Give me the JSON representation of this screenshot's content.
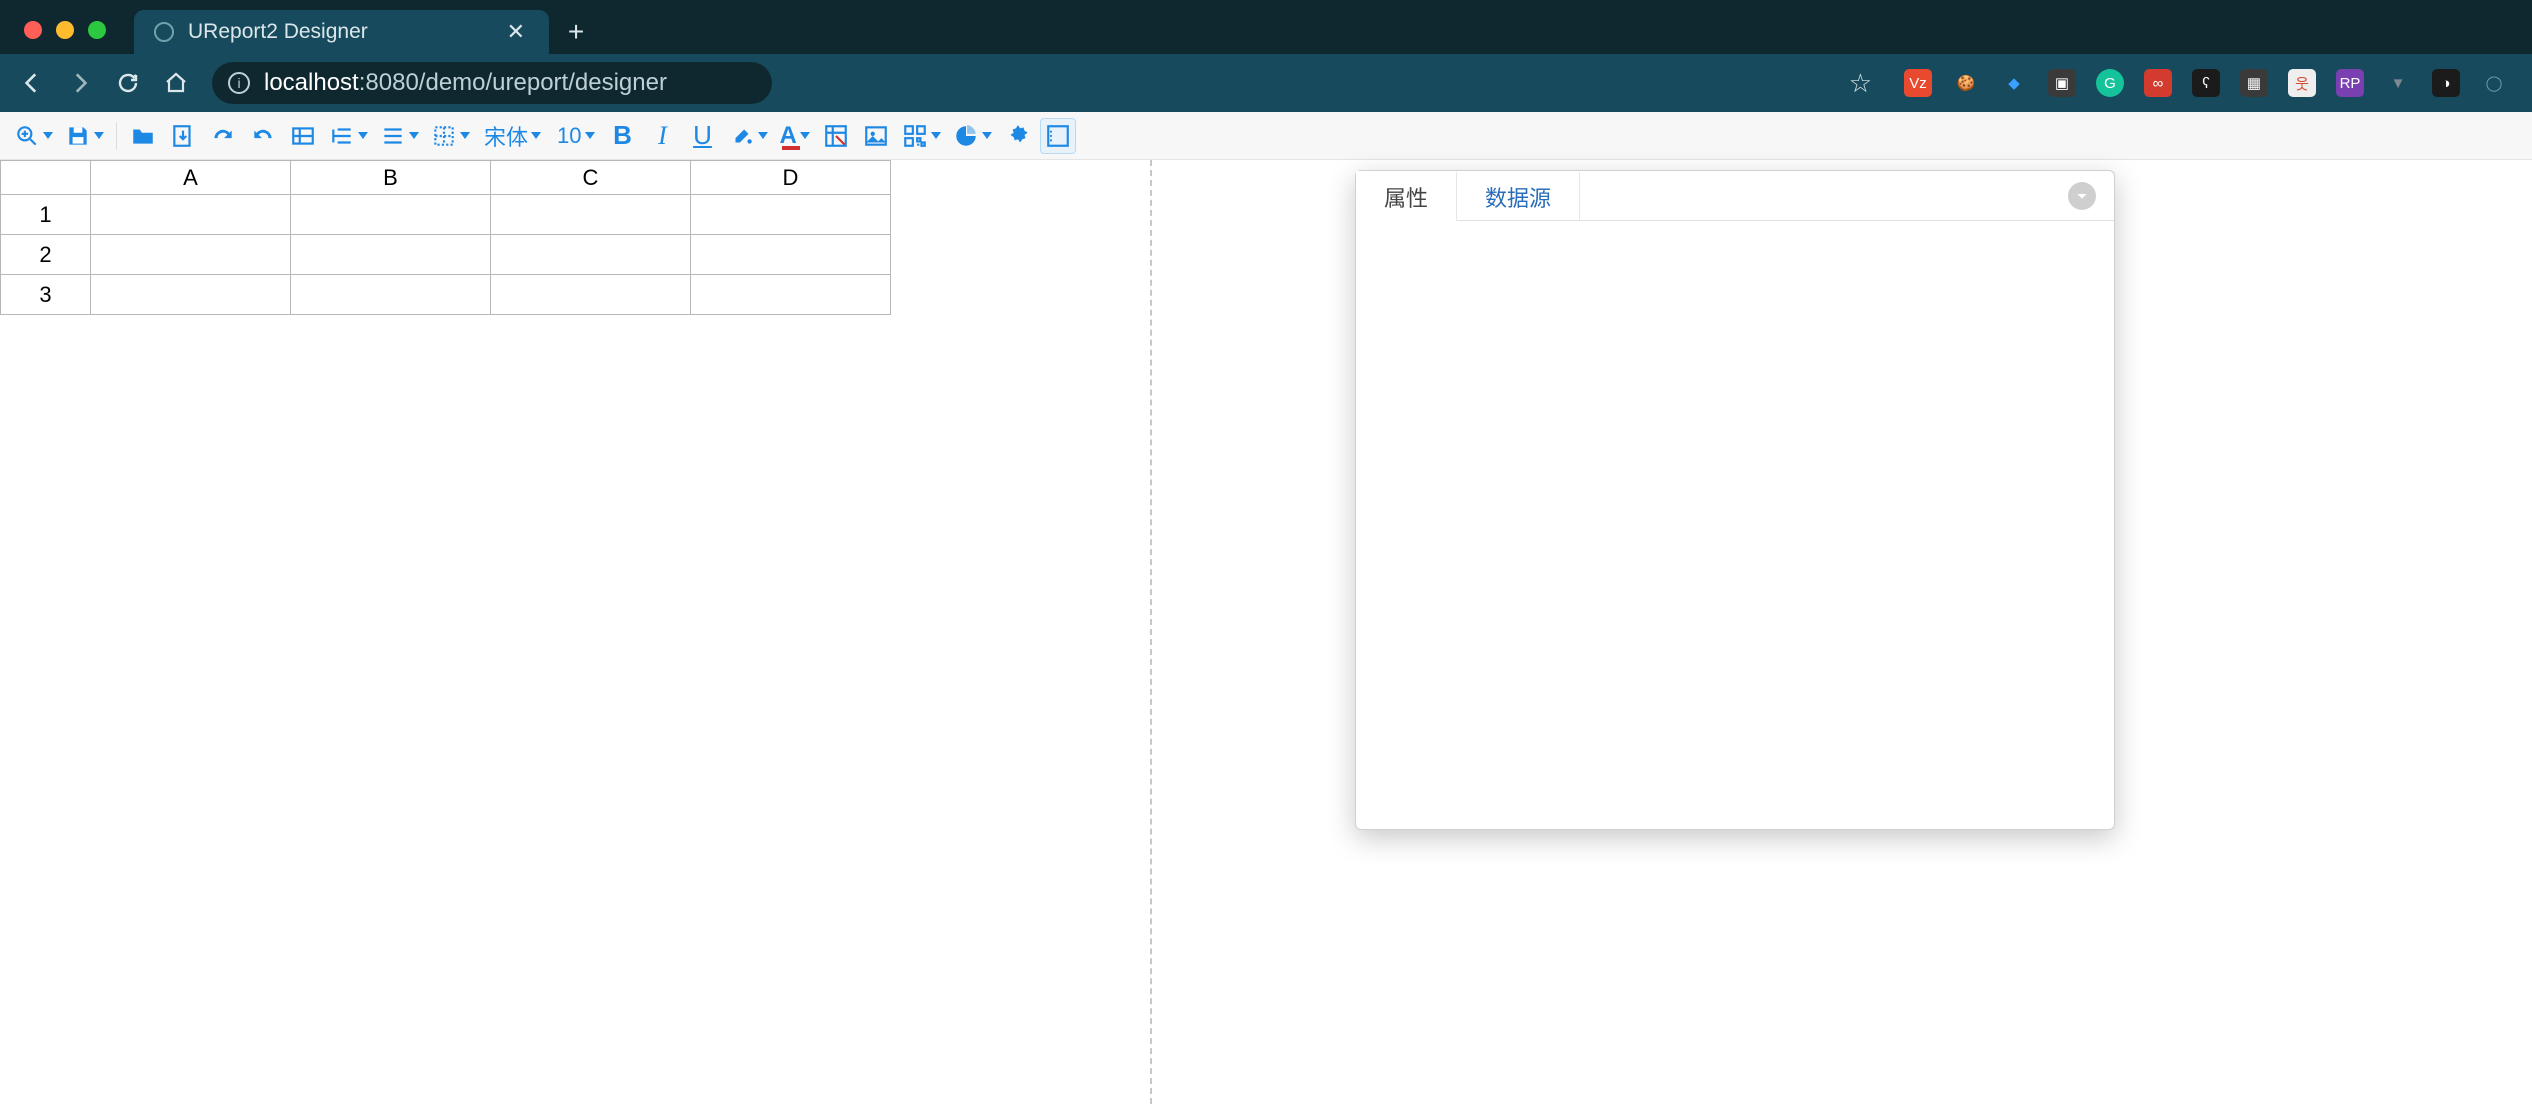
{
  "browser": {
    "tab_title": "UReport2 Designer",
    "url_host": "localhost",
    "url_port": ":8080",
    "url_path": "/demo/ureport/designer",
    "extensions": [
      {
        "name": "ext-1",
        "bg": "#e94a2f",
        "label": "Vz"
      },
      {
        "name": "ext-cookie",
        "bg": "transparent",
        "label": "🍪"
      },
      {
        "name": "ext-diamond",
        "bg": "transparent",
        "label": "◆",
        "color": "#3aa0ff"
      },
      {
        "name": "ext-cam",
        "bg": "#3a3a3a",
        "label": "▣"
      },
      {
        "name": "ext-grammarly",
        "bg": "#15c39a",
        "label": "G",
        "round": true
      },
      {
        "name": "ext-infinity",
        "bg": "#d43b2f",
        "label": "∞"
      },
      {
        "name": "ext-cat",
        "bg": "#1b1b1b",
        "label": "ʕ"
      },
      {
        "name": "ext-frame",
        "bg": "#3a3a3a",
        "label": "▦"
      },
      {
        "name": "ext-person",
        "bg": "#eee",
        "label": "웃",
        "color": "#d84b2f"
      },
      {
        "name": "ext-rp",
        "bg": "#7a3fb0",
        "label": "RP"
      },
      {
        "name": "ext-vue",
        "bg": "transparent",
        "label": "▼",
        "color": "#7d8892"
      },
      {
        "name": "ext-dark",
        "bg": "#1b1b1b",
        "label": "◑"
      },
      {
        "name": "ext-circle",
        "bg": "transparent",
        "label": "◯",
        "color": "#6fa2ad"
      }
    ]
  },
  "toolbar": {
    "font_family_label": "宋体",
    "font_size_label": "10",
    "bold_label": "B",
    "italic_label": "I",
    "underline_label": "U",
    "font_color_label": "A"
  },
  "grid": {
    "columns": [
      "A",
      "B",
      "C",
      "D"
    ],
    "rows": [
      "1",
      "2",
      "3"
    ]
  },
  "panel": {
    "tab_properties": "属性",
    "tab_datasource": "数据源"
  }
}
